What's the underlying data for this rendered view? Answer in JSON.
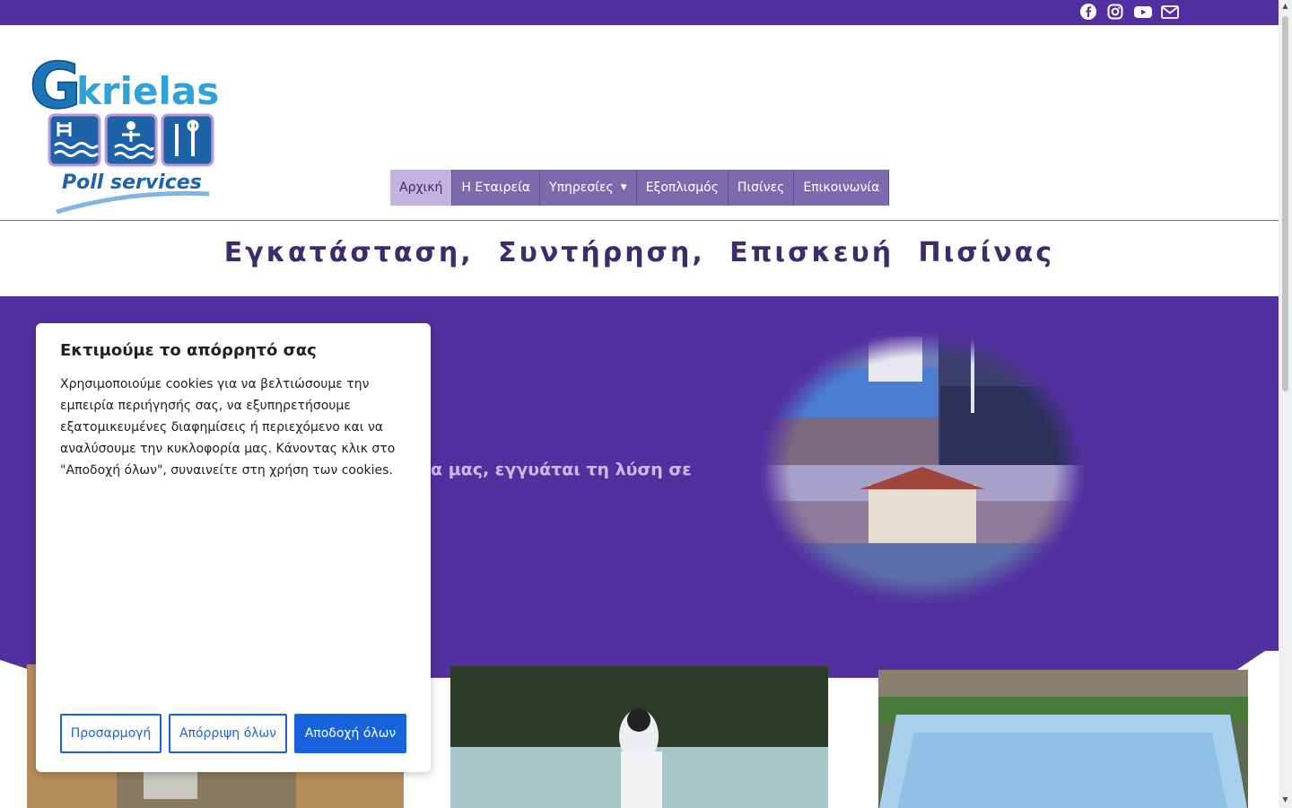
{
  "topbar": {
    "icons": [
      "facebook-icon",
      "instagram-icon",
      "youtube-icon",
      "mail-icon"
    ],
    "color": "#522fa0"
  },
  "logo": {
    "name_g": "G",
    "name_rest": "krielas",
    "subtitle": "Poll services"
  },
  "nav": {
    "items": [
      {
        "label": "Αρχική",
        "active": true
      },
      {
        "label": "Η Εταιρεία",
        "active": false
      },
      {
        "label": "Υπηρεσίες",
        "active": false,
        "dropdown": true
      },
      {
        "label": "Εξοπλισμός",
        "active": false
      },
      {
        "label": "Πισίνες",
        "active": false
      },
      {
        "label": "Επικοινωνία",
        "active": false
      }
    ]
  },
  "tagline": "Εγκατάσταση, Συντήρηση, Επισκευή Πισίνας",
  "hero": {
    "text": "α μας,  εγγυάται τη λύση σε",
    "color": "#5330a0"
  },
  "cookie": {
    "title": "Εκτιμούμε το απόρρητό σας",
    "body": "Χρησιμοποιούμε cookies για να βελτιώσουμε την εμπειρία περιήγησής σας, να εξυπηρετήσουμε εξατομικευμένες διαφημίσεις ή περιεχόμενο και να αναλύσουμε την κυκλοφορία μας. Κάνοντας κλικ στο \"Αποδοχή όλων\", συναινείτε στη χρήση των cookies.",
    "customize": "Προσαρμογή",
    "reject": "Απόρριψη όλων",
    "accept": "Αποδοχή όλων",
    "accent": "#1863dc"
  }
}
